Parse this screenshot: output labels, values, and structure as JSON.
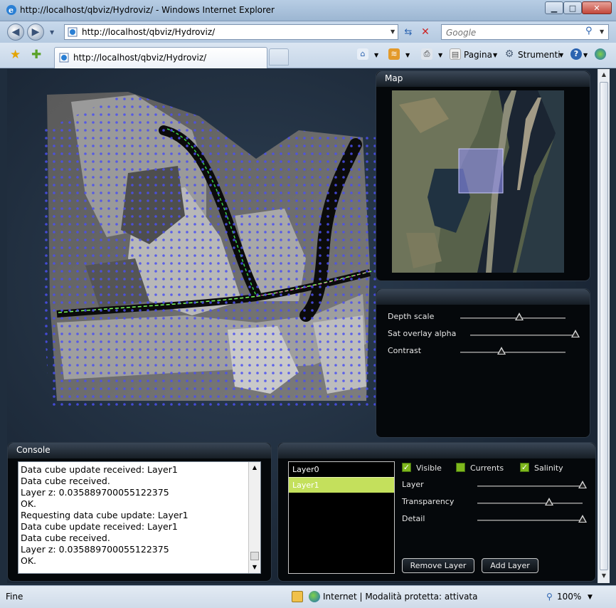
{
  "window": {
    "title": "http://localhost/qbviz/Hydroviz/ - Windows Internet Explorer",
    "controls": {
      "minimize": "▁",
      "maximize": "□",
      "close": "✕"
    }
  },
  "address_bar": {
    "url": "http://localhost/qbviz/Hydroviz/",
    "search_placeholder": "Google"
  },
  "tab": {
    "label": "http://localhost/qbviz/Hydroviz/"
  },
  "command_bar": {
    "page_label": "Pagina",
    "tools_label": "Strumenti"
  },
  "map_panel": {
    "title": "Map"
  },
  "settings_panel": {
    "sliders": [
      {
        "label": "Depth scale",
        "value": 0.56
      },
      {
        "label": "Sat overlay alpha",
        "value": 1.0
      },
      {
        "label": "Contrast",
        "value": 0.39
      }
    ]
  },
  "console": {
    "title": "Console",
    "lines": [
      "Data cube update received: Layer1",
      "Data cube received.",
      "Layer z: 0.035889700055122375",
      "OK.",
      "Requesting data cube update: Layer1",
      "Data cube update received: Layer1",
      "Data cube received.",
      "Layer z: 0.035889700055122375",
      "OK."
    ]
  },
  "layers_panel": {
    "layers": [
      "Layer0",
      "Layer1"
    ],
    "selected_index": 1,
    "checkboxes": [
      {
        "label": "Visible",
        "checked": true
      },
      {
        "label": "Currents",
        "checked": false
      },
      {
        "label": "Salinity",
        "checked": true
      }
    ],
    "sliders": [
      {
        "label": "Layer",
        "value": 1.0
      },
      {
        "label": "Transparency",
        "value": 0.68
      },
      {
        "label": "Detail",
        "value": 1.0
      }
    ],
    "remove_button": "Remove Layer",
    "add_button": "Add Layer"
  },
  "status_bar": {
    "left_text": "Fine",
    "zone_text": "Internet | Modalità protetta: attivata",
    "zoom": "100%"
  },
  "colors": {
    "accent_selected": "#c4e05c",
    "checkbox_green": "#7fb81d",
    "panel_bg": "#05080b"
  }
}
